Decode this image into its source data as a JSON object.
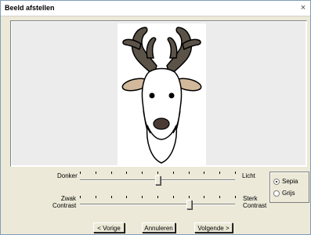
{
  "window": {
    "title": "Beeld afstellen",
    "close_glyph": "×"
  },
  "image": {
    "subject": "reindeer-head-drawing",
    "colors": {
      "antler": "#5c5348",
      "outline": "#000000",
      "ear_inner": "#d2b99b",
      "nose": "#4a3c34",
      "fill": "#ffffff"
    }
  },
  "sliders": {
    "brightness": {
      "left_label": "Donker",
      "right_label": "Licht",
      "ticks": 11,
      "value": 0.5
    },
    "contrast": {
      "left_label": "Zwak\nContrast",
      "right_label": "Sterk\nContrast",
      "ticks": 11,
      "value": 0.7
    }
  },
  "color_mode": {
    "options": [
      {
        "label": "Sepia",
        "checked": true
      },
      {
        "label": "Grijs",
        "checked": false
      }
    ]
  },
  "buttons": {
    "previous": "< Vorige",
    "cancel": "Annuleren",
    "next": "Volgende >"
  }
}
